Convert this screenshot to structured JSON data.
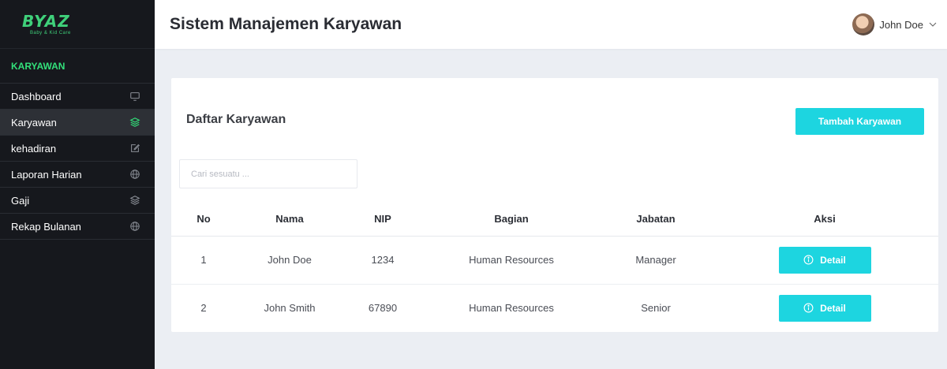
{
  "sidebar": {
    "logo_text": "BYAZ",
    "logo_sub": "Baby & Kid Care",
    "section_label": "KARYAWAN",
    "items": [
      {
        "label": "Dashboard",
        "icon": "monitor-icon"
      },
      {
        "label": "Karyawan",
        "icon": "layers-icon",
        "active": true
      },
      {
        "label": "kehadiran",
        "icon": "edit-icon"
      },
      {
        "label": "Laporan Harian",
        "icon": "globe-icon"
      },
      {
        "label": "Gaji",
        "icon": "layers-icon"
      },
      {
        "label": "Rekap Bulanan",
        "icon": "globe-icon"
      }
    ]
  },
  "header": {
    "title": "Sistem Manajemen Karyawan",
    "user_name": "John Doe"
  },
  "main": {
    "card_title": "Daftar Karyawan",
    "add_button_label": "Tambah Karyawan",
    "search_placeholder": "Cari sesuatu ...",
    "table": {
      "headers": [
        "No",
        "Nama",
        "NIP",
        "Bagian",
        "Jabatan",
        "Aksi"
      ],
      "rows": [
        {
          "no": "1",
          "nama": "John Doe",
          "nip": "1234",
          "bagian": "Human Resources",
          "jabatan": "Manager",
          "action_label": "Detail"
        },
        {
          "no": "2",
          "nama": "John Smith",
          "nip": "67890",
          "bagian": "Human Resources",
          "jabatan": "Senior",
          "action_label": "Detail"
        }
      ]
    }
  },
  "colors": {
    "accent": "#1dd5e0",
    "brand_green": "#32e07a",
    "sidebar_bg": "#16181d"
  }
}
